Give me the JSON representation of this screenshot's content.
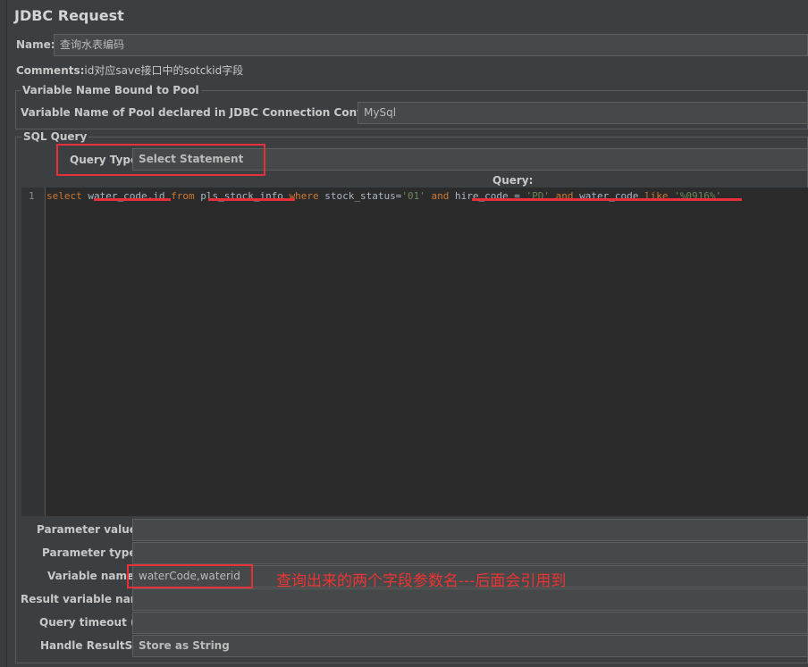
{
  "title": "JDBC Request",
  "name": {
    "label": "Name:",
    "value": "查询水表编码"
  },
  "comments": {
    "label": "Comments:",
    "value": "id对应save接口中的sotckid字段"
  },
  "pool": {
    "legend": "Variable Name Bound to Pool",
    "label": "Variable Name of Pool declared in JDBC Connection Configuration:",
    "value": "MySql"
  },
  "sql": {
    "legend": "SQL Query",
    "query_type_label": "Query Type:",
    "query_type_value": "Select Statement",
    "query_label": "Query:",
    "line_number": "1",
    "tokens": [
      {
        "t": "select",
        "c": "kw"
      },
      {
        "t": " water_code,id ",
        "c": "id"
      },
      {
        "t": "from",
        "c": "kw"
      },
      {
        "t": " pls_stock_info ",
        "c": "id"
      },
      {
        "t": "where",
        "c": "kw"
      },
      {
        "t": " stock_status=",
        "c": "id"
      },
      {
        "t": "'01'",
        "c": "str"
      },
      {
        "t": " ",
        "c": "id"
      },
      {
        "t": "and",
        "c": "kw"
      },
      {
        "t": " hire_code = ",
        "c": "id"
      },
      {
        "t": "'PD'",
        "c": "str"
      },
      {
        "t": " ",
        "c": "id"
      },
      {
        "t": "and",
        "c": "kw"
      },
      {
        "t": " water_code ",
        "c": "id"
      },
      {
        "t": "like",
        "c": "kw"
      },
      {
        "t": " ",
        "c": "id"
      },
      {
        "t": "'%0916%'",
        "c": "str"
      }
    ]
  },
  "params": {
    "parameter_values_label": "Parameter values:",
    "parameter_values": "",
    "parameter_types_label": "Parameter types:",
    "parameter_types": "",
    "variable_names_label": "Variable names:",
    "variable_names": "waterCode,waterid",
    "result_variable_label": "Result variable name:",
    "result_variable": "",
    "query_timeout_label": "Query timeout (s):",
    "query_timeout": "",
    "handle_resultset_label": "Handle ResultSet:",
    "handle_resultset": "Store as String"
  },
  "annotation": "查询出来的两个字段参数名---后面会引用到",
  "colors": {
    "annotation_red": "#e8303a",
    "keyword": "#cc7832",
    "string": "#6a8759"
  }
}
